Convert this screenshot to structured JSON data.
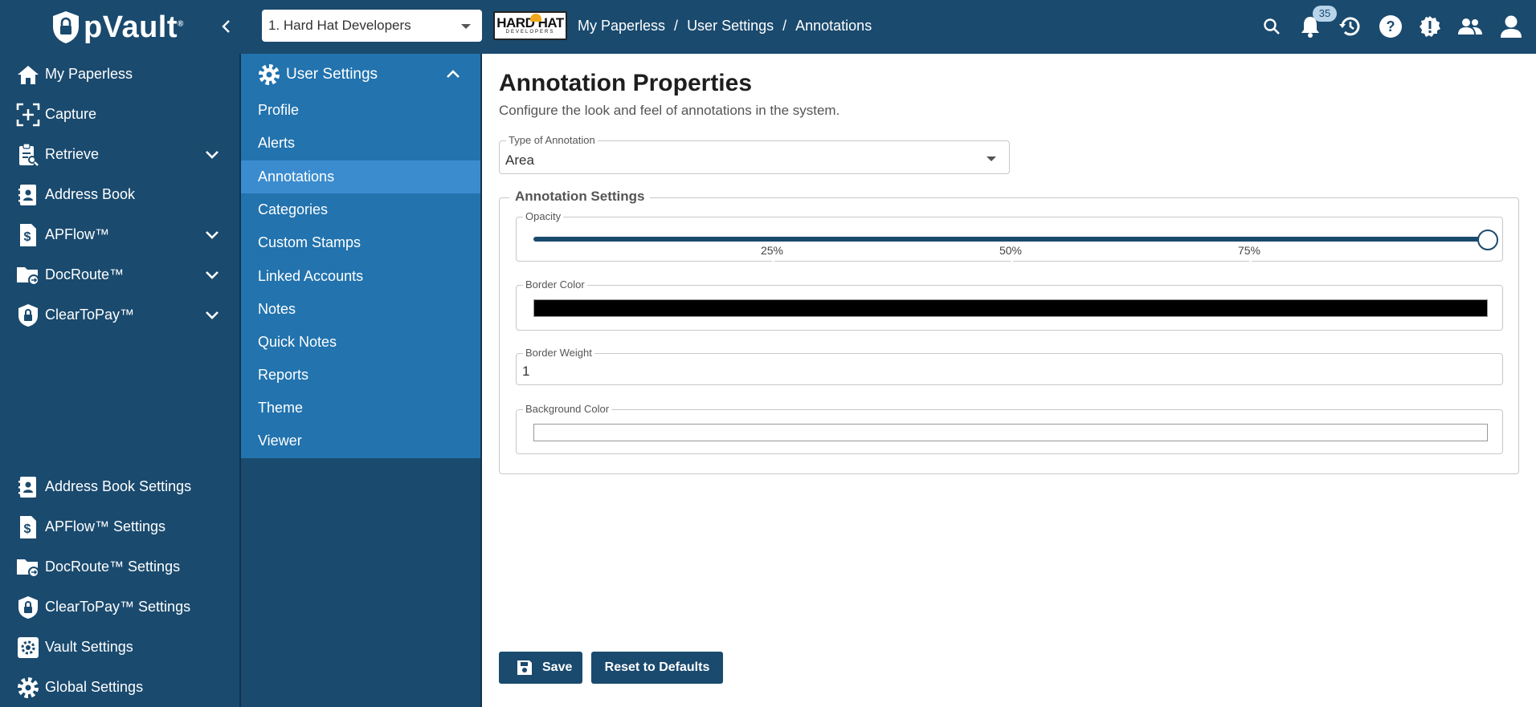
{
  "app": {
    "name": "pVault",
    "trademark": "®"
  },
  "org_selector": {
    "value": "1. Hard Hat Developers"
  },
  "org_logo": {
    "main": "HARD HAT",
    "sub": "DEVELOPERS"
  },
  "breadcrumb": [
    "My Paperless",
    "User Settings",
    "Annotations"
  ],
  "notifications": {
    "count": "35"
  },
  "left_nav": {
    "top_items": [
      {
        "label": "My Paperless",
        "icon": "home-icon"
      },
      {
        "label": "Capture",
        "icon": "capture-icon"
      },
      {
        "label": "Retrieve",
        "icon": "retrieve-icon",
        "expandable": true
      },
      {
        "label": "Address Book",
        "icon": "address-book-icon"
      },
      {
        "label": "APFlow™",
        "icon": "apflow-icon",
        "expandable": true
      },
      {
        "label": "DocRoute™",
        "icon": "docroute-icon",
        "expandable": true
      },
      {
        "label": "ClearToPay™",
        "icon": "cleartopay-icon",
        "expandable": true
      }
    ],
    "bottom_items": [
      {
        "label": "Address Book Settings",
        "icon": "address-book-icon"
      },
      {
        "label": "APFlow™ Settings",
        "icon": "apflow-icon"
      },
      {
        "label": "DocRoute™ Settings",
        "icon": "docroute-icon"
      },
      {
        "label": "ClearToPay™ Settings",
        "icon": "cleartopay-icon"
      },
      {
        "label": "Vault Settings",
        "icon": "gear-icon"
      },
      {
        "label": "Global Settings",
        "icon": "gear-icon"
      }
    ]
  },
  "sub_nav": {
    "header": "User Settings",
    "items": [
      "Profile",
      "Alerts",
      "Annotations",
      "Categories",
      "Custom Stamps",
      "Linked Accounts",
      "Notes",
      "Quick Notes",
      "Reports",
      "Theme",
      "Viewer"
    ],
    "active": "Annotations"
  },
  "page": {
    "title": "Annotation Properties",
    "subtitle": "Configure the look and feel of annotations in the system."
  },
  "form": {
    "type_label": "Type of Annotation",
    "type_value": "Area",
    "group_title": "Annotation Settings",
    "opacity_label": "Opacity",
    "opacity_value": 1.0,
    "opacity_ticks": [
      "25%",
      "50%",
      "75%"
    ],
    "border_color_label": "Border Color",
    "border_color_value": "#000000",
    "border_weight_label": "Border Weight",
    "border_weight_value": "1",
    "background_color_label": "Background Color",
    "background_color_value": "#ffffff"
  },
  "buttons": {
    "save": "Save",
    "reset": "Reset to Defaults"
  },
  "colors": {
    "brand_dark": "#1a4a6e",
    "brand_mid": "#2273ae",
    "brand_active": "#3b8ccf"
  }
}
